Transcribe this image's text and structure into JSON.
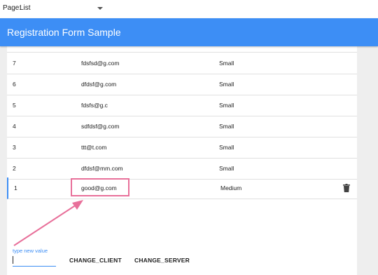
{
  "page_selector": {
    "label": "Page:",
    "value": "List"
  },
  "app_bar": {
    "title": "Registration Form Sample"
  },
  "table": {
    "rows": [
      {
        "id": "7",
        "email": "fdsfsd@g.com",
        "size": "Small"
      },
      {
        "id": "6",
        "email": "dfdsf@g.com",
        "size": "Small"
      },
      {
        "id": "5",
        "email": "fdsfs@g.c",
        "size": "Small"
      },
      {
        "id": "4",
        "email": "sdfdsf@g.com",
        "size": "Small"
      },
      {
        "id": "3",
        "email": "ttt@t.com",
        "size": "Small"
      },
      {
        "id": "2",
        "email": "dfdsf@mm.com",
        "size": "Small"
      },
      {
        "id": "1",
        "email": "good@g.com",
        "size": "Medium",
        "selected": true
      }
    ]
  },
  "editor": {
    "input_label": "type new value",
    "input_value": "",
    "change_client_label": "CHANGE_CLIENT",
    "change_server_label": "CHANGE_SERVER"
  },
  "colors": {
    "accent": "#3d8ef5",
    "annotation": "#e8709a"
  },
  "icons": {
    "delete": "trash-icon",
    "dropdown": "chevron-down-icon"
  }
}
